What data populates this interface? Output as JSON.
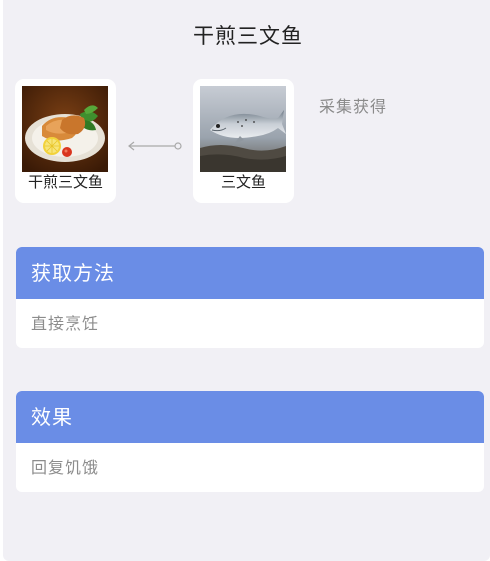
{
  "page": {
    "title": "干煎三文鱼"
  },
  "recipe": {
    "result": {
      "name": "干煎三文鱼",
      "image_icon": "pan-fried-salmon-dish-image"
    },
    "ingredient": {
      "name": "三文鱼",
      "image_icon": "salmon-fish-image"
    },
    "connector_icon": "arrow-left-icon",
    "source_text": "采集获得"
  },
  "sections": {
    "obtain": {
      "header": "获取方法",
      "body": "直接烹饪"
    },
    "effect": {
      "header": "效果",
      "body": "回复饥饿"
    }
  },
  "colors": {
    "background": "#f1f0f5",
    "section_header": "#6a8de6",
    "card": "#ffffff",
    "muted_text": "#8c8c8c"
  }
}
